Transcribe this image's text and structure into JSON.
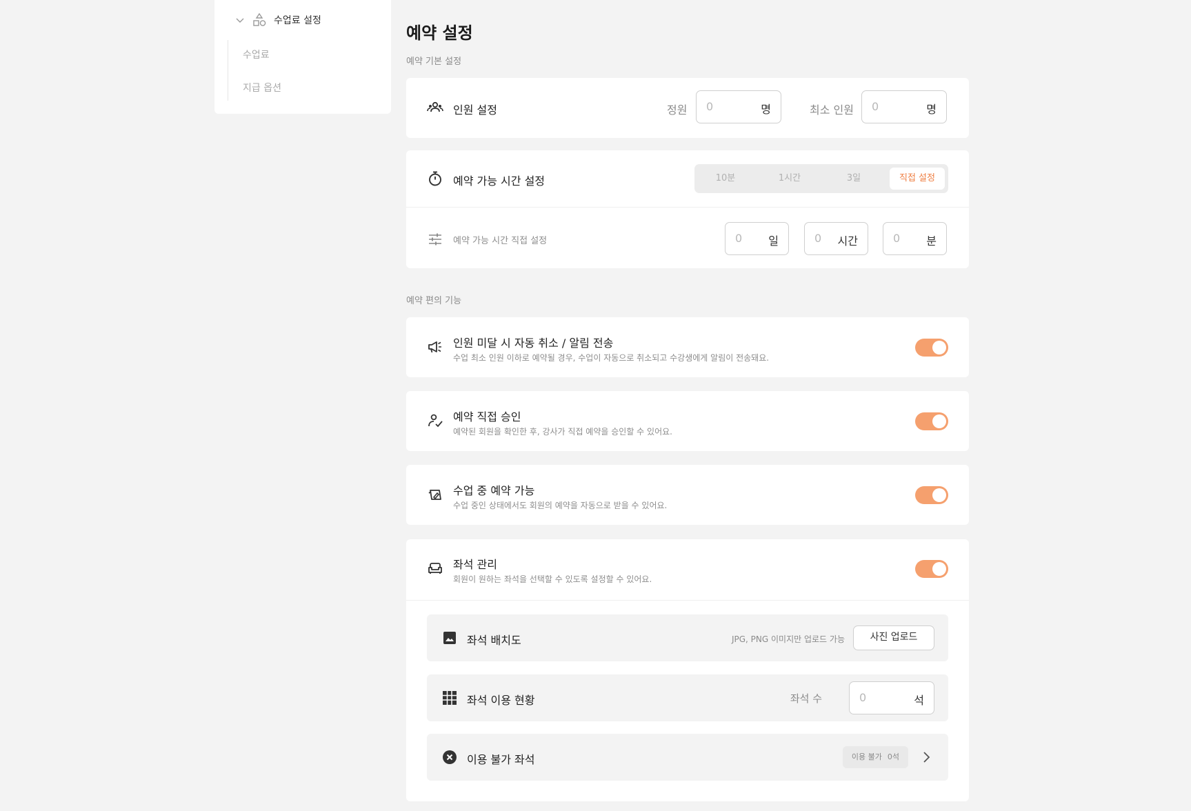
{
  "sidebar": {
    "group_label": "수업료 설정",
    "items": [
      {
        "label": "수업료"
      },
      {
        "label": "지급 옵션"
      }
    ]
  },
  "page": {
    "title": "예약 설정",
    "section_basic": "예약 기본 설정",
    "section_convenience": "예약 편의 기능"
  },
  "capacity": {
    "title": "인원 설정",
    "capacity_label": "정원",
    "capacity_placeholder": "0",
    "capacity_unit": "명",
    "min_label": "최소 인원",
    "min_placeholder": "0",
    "min_unit": "명"
  },
  "booking_time": {
    "title": "예약 가능 시간 설정",
    "options": [
      "10분",
      "1시간",
      "3일",
      "직접 설정"
    ],
    "selected": "직접 설정",
    "custom_title": "예약 가능 시간 직접 설정",
    "day_placeholder": "0",
    "day_unit": "일",
    "hour_placeholder": "0",
    "hour_unit": "시간",
    "minute_placeholder": "0",
    "minute_unit": "분"
  },
  "features": [
    {
      "title": "인원 미달 시 자동 취소 / 알림 전송",
      "desc": "수업 최소 인원 이하로 예약될 경우, 수업이 자동으로 취소되고 수강생에게 알림이 전송돼요.",
      "enabled": true
    },
    {
      "title": "예약 직접 승인",
      "desc": "예약된 회원을 확인한 후, 강사가 직접 예약을 승인할 수 있어요.",
      "enabled": true
    },
    {
      "title": "수업 중 예약 가능",
      "desc": "수업 중인 상태에서도 회원의 예약을 자동으로 받을 수 있어요.",
      "enabled": true
    },
    {
      "title": "좌석 관리",
      "desc": "회원이 원하는 좌석을 선택할 수 있도록 설정할 수 있어요.",
      "enabled": true
    }
  ],
  "seat": {
    "layout_title": "좌석 배치도",
    "layout_hint": "JPG, PNG 이미지만 업로드 가능",
    "upload_label": "사진 업로드",
    "status_title": "좌석 이용 현황",
    "count_label": "좌석 수",
    "count_placeholder": "0",
    "count_unit": "석",
    "unavailable_title": "이용 불가 좌석",
    "unavailable_badge_label": "이용 불가",
    "unavailable_badge_count": "0석"
  },
  "colors": {
    "accent": "#ef7f43",
    "toggle_on": "#f5a06e"
  }
}
